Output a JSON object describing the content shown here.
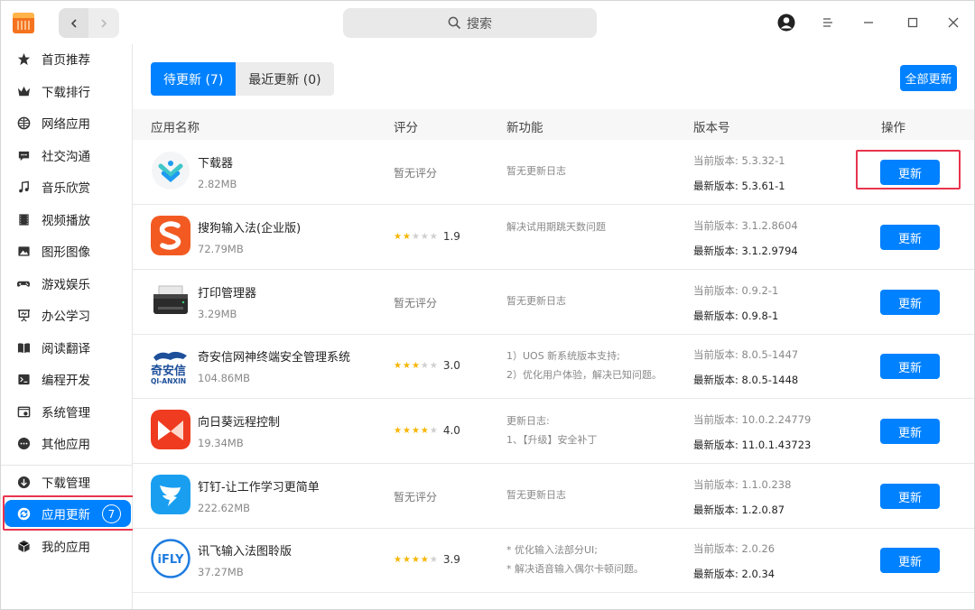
{
  "titlebar": {
    "search_placeholder": "搜索"
  },
  "sidebar": {
    "items": [
      {
        "label": "首页推荐",
        "icon": "star-icon"
      },
      {
        "label": "下载排行",
        "icon": "crown-icon"
      },
      {
        "label": "网络应用",
        "icon": "globe-icon"
      },
      {
        "label": "社交沟通",
        "icon": "chat-icon"
      },
      {
        "label": "音乐欣赏",
        "icon": "music-icon"
      },
      {
        "label": "视频播放",
        "icon": "film-icon"
      },
      {
        "label": "图形图像",
        "icon": "image-icon"
      },
      {
        "label": "游戏娱乐",
        "icon": "gamepad-icon"
      },
      {
        "label": "办公学习",
        "icon": "presentation-icon"
      },
      {
        "label": "阅读翻译",
        "icon": "book-icon"
      },
      {
        "label": "编程开发",
        "icon": "terminal-icon"
      },
      {
        "label": "系统管理",
        "icon": "system-icon"
      },
      {
        "label": "其他应用",
        "icon": "more-icon"
      }
    ],
    "bottom_items": [
      {
        "label": "下载管理",
        "icon": "download-icon"
      },
      {
        "label": "应用更新",
        "icon": "refresh-icon",
        "badge": "7"
      },
      {
        "label": "我的应用",
        "icon": "box-icon"
      }
    ]
  },
  "main": {
    "tabs": [
      {
        "label": "待更新 (7)"
      },
      {
        "label": "最近更新 (0)"
      }
    ],
    "update_all_label": "全部更新",
    "columns": {
      "name": "应用名称",
      "rating": "评分",
      "features": "新功能",
      "version": "版本号",
      "action": "操作"
    },
    "apps": [
      {
        "name": "下载器",
        "size": "2.82MB",
        "rating_text": "暂无评分",
        "stars": 0,
        "rating": "",
        "features": [
          "暂无更新日志"
        ],
        "current": "当前版本:  5.3.32-1",
        "latest": "最新版本:  5.3.61-1",
        "button": "更新"
      },
      {
        "name": "搜狗输入法(企业版)",
        "size": "72.79MB",
        "rating_text": "",
        "stars": 2,
        "rating": "1.9",
        "features": [
          "解决试用期跳天数问题"
        ],
        "current": "当前版本:  3.1.2.8604",
        "latest": "最新版本:  3.1.2.9794",
        "button": "更新"
      },
      {
        "name": "打印管理器",
        "size": "3.29MB",
        "rating_text": "暂无评分",
        "stars": 0,
        "rating": "",
        "features": [
          "暂无更新日志"
        ],
        "current": "当前版本:  0.9.2-1",
        "latest": "最新版本:  0.9.8-1",
        "button": "更新"
      },
      {
        "name": "奇安信网神终端安全管理系统",
        "size": "104.86MB",
        "rating_text": "",
        "stars": 3,
        "rating": "3.0",
        "features": [
          "1）UOS 新系统版本支持;",
          "2）优化用户体验，解决已知问题。"
        ],
        "current": "当前版本:  8.0.5-1447",
        "latest": "最新版本:  8.0.5-1448",
        "button": "更新"
      },
      {
        "name": "向日葵远程控制",
        "size": "19.34MB",
        "rating_text": "",
        "stars": 4,
        "rating": "4.0",
        "features": [
          "更新日志:",
          "1、【升级】安全补丁"
        ],
        "current": "当前版本:  10.0.2.24779",
        "latest": "最新版本:  11.0.1.43723",
        "button": "更新"
      },
      {
        "name": "钉钉-让工作学习更简单",
        "size": "222.62MB",
        "rating_text": "暂无评分",
        "stars": 0,
        "rating": "",
        "features": [
          "暂无更新日志"
        ],
        "current": "当前版本:  1.1.0.238",
        "latest": "最新版本:  1.2.0.87",
        "button": "更新"
      },
      {
        "name": "讯飞输入法图聆版",
        "size": "37.27MB",
        "rating_text": "",
        "stars": 4,
        "rating": "3.9",
        "features": [
          "* 优化输入法部分UI;",
          "* 解决语音输入偶尔卡顿问题。"
        ],
        "current": "当前版本:  2.0.26",
        "latest": "最新版本:  2.0.34",
        "button": "更新"
      }
    ],
    "logo_texts": {
      "qianxin_cn": "奇安信",
      "qianxin_en": "QI-ANXIN",
      "ifly": "iFLY"
    }
  },
  "colors": {
    "accent": "#0081ff",
    "highlight": "#e8344e",
    "star": "#f7b500"
  }
}
